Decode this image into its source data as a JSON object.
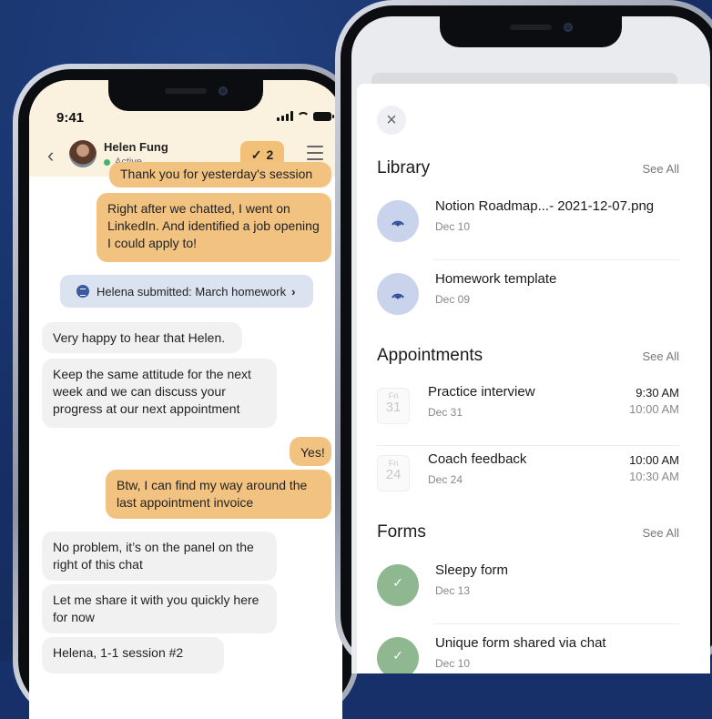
{
  "left_phone": {
    "status": {
      "time": "9:41"
    },
    "header": {
      "name": "Helen Fung",
      "status": "Active",
      "badge_check": "✓",
      "badge_count": "2"
    },
    "messages": [
      {
        "text": "Thank you for yesterday's session",
        "side": "out"
      },
      {
        "text": "Right after we chatted, I went on LinkedIn. And identified a job opening I could apply to!",
        "side": "out"
      },
      {
        "text": "Very happy to hear that Helen.",
        "side": "in"
      },
      {
        "text": "Keep the same attitude for the next week and we can discuss your progress at our next appointment",
        "side": "in"
      },
      {
        "text": "Yes!",
        "side": "out"
      },
      {
        "text": "Btw, I can find my way around the last appointment invoice",
        "side": "out"
      },
      {
        "text": "No problem, it’s on the panel on the right of this chat",
        "side": "in"
      },
      {
        "text": "Let me share it with you quickly here for now",
        "side": "in"
      },
      {
        "text": "Helena, 1-1 session #2",
        "side": "in"
      }
    ],
    "system_message": {
      "text": "Helena submitted: March homework",
      "chevron": "›"
    }
  },
  "right_phone": {
    "close_symbol": "×",
    "library": {
      "title": "Library",
      "see_all": "See All",
      "items": [
        {
          "title": "Notion  Roadmap...- 2021-12-07.png",
          "date": "Dec 10"
        },
        {
          "title": "Homework template",
          "date": "Dec 09"
        }
      ]
    },
    "appointments": {
      "title": "Appointments",
      "see_all": "See All",
      "items": [
        {
          "day_name": "Fri",
          "day_num": "31",
          "title": "Practice interview",
          "date": "Dec 31",
          "start": "9:30 AM",
          "end": "10:00 AM"
        },
        {
          "day_name": "Fri",
          "day_num": "24",
          "title": "Coach feedback",
          "date": "Dec 24",
          "start": "10:00 AM",
          "end": "10:30 AM"
        }
      ]
    },
    "forms": {
      "title": "Forms",
      "see_all": "See All",
      "items": [
        {
          "title": "Sleepy form",
          "date": "Dec 13"
        },
        {
          "title": "Unique form shared via chat",
          "date": "Dec 10"
        }
      ]
    }
  },
  "colors": {
    "background": "#18306a",
    "outgoing_bubble": "#f2c380",
    "incoming_bubble": "#f1f1f1",
    "library_icon_bg": "#c9d4ec",
    "form_icon_bg": "#8fb891",
    "active_dot": "#45b36b"
  }
}
